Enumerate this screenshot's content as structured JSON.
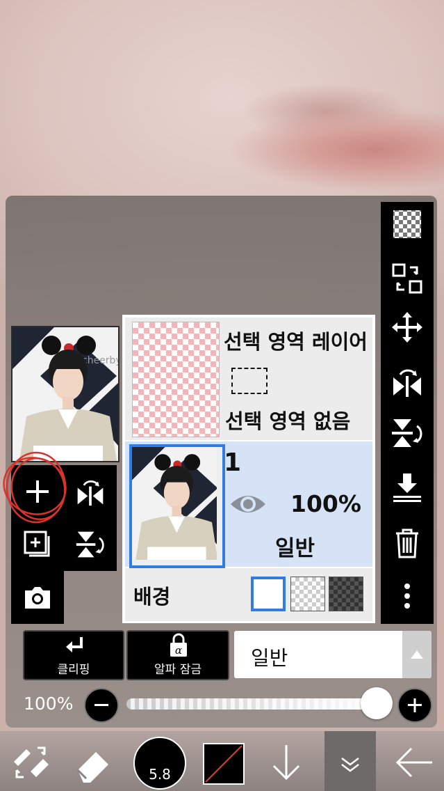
{
  "selection_layer": {
    "title": "선택 영역 레이어",
    "status": "선택 영역 없음"
  },
  "layer1": {
    "number": "1",
    "opacity": "100%",
    "blend": "일반"
  },
  "background_row": {
    "label": "배경"
  },
  "buttons": {
    "clipping_label": "클리핑",
    "alpha_lock_label": "알파 잠금"
  },
  "blend_mode": {
    "selected": "일반"
  },
  "opacity_slider": {
    "label": "100%",
    "value": 1.0
  },
  "brush": {
    "size": "5.8"
  },
  "preview_image": {
    "watermark_text": "cheerby"
  },
  "colors": {
    "selection_highlight": "#2f7ce6",
    "layer_selected_bg": "#d6e3f6",
    "annotation_circle": "#d9342b"
  }
}
